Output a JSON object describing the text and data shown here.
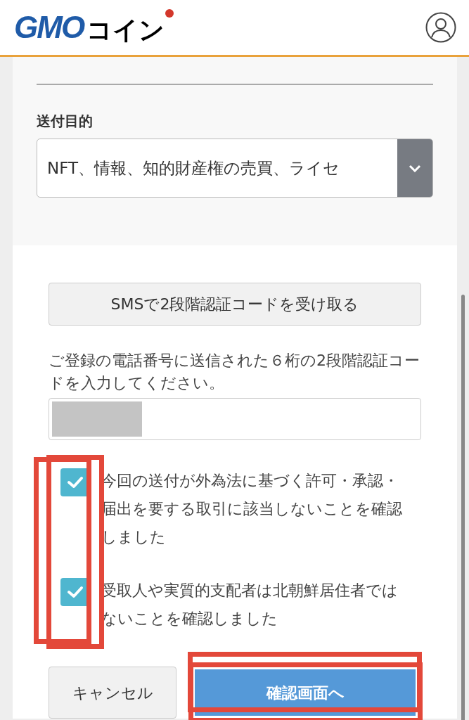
{
  "header": {
    "logo": {
      "latin": "GMO",
      "kana": "コイン"
    }
  },
  "purpose": {
    "label": "送付目的",
    "value": "NFT、情報、知的財産権の売買、ライセ"
  },
  "sms_button": "SMSで2段階認証コードを受け取る",
  "code_instruction": "ご登録の電話番号に送信された６桁の2段階認証コードを入力してください。",
  "code_field": {
    "redacted": true
  },
  "confirmations": [
    {
      "text": "今回の送付が外為法に基づく許可・承認・届出を要する取引に該当しないことを確認しました",
      "checked": true
    },
    {
      "text": "受取人や実質的支配者は北朝鮮居住者ではないことを確認しました",
      "checked": true
    }
  ],
  "buttons": [
    {
      "label": "キャンセル",
      "kind": "secondary"
    },
    {
      "label": "確認画面へ",
      "kind": "primary"
    }
  ],
  "highlights": {
    "checkboxes": true,
    "confirm_button": true
  }
}
